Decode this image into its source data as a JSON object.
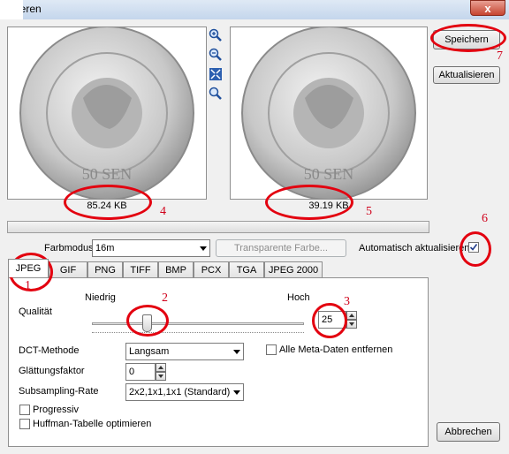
{
  "window": {
    "title": "ortieren",
    "close_glyph": "x"
  },
  "preview": {
    "original_size": "85.24 KB",
    "preview_size": "39.19 KB",
    "tools": [
      "zoom-in-icon",
      "zoom-out-icon",
      "fit-icon",
      "magnify-icon"
    ]
  },
  "buttons": {
    "save": "Speichern",
    "refresh": "Aktualisieren",
    "cancel": "Abbrechen",
    "transparent": "Transparente Farbe..."
  },
  "options_row": {
    "color_mode_label": "Farbmodus",
    "color_mode_value": "16m",
    "auto_update_label": "Automatisch aktualisieren",
    "auto_update_checked": true
  },
  "tabs": [
    "JPEG",
    "GIF",
    "PNG",
    "TIFF",
    "BMP",
    "PCX",
    "TGA",
    "JPEG 2000"
  ],
  "active_tab": "JPEG",
  "jpeg": {
    "quality_label": "Qualität",
    "low_label": "Niedrig",
    "high_label": "Hoch",
    "quality_value": "25",
    "quality_fraction": 0.25,
    "dct_label": "DCT-Methode",
    "dct_value": "Langsam",
    "remove_meta_label": "Alle Meta-Daten entfernen",
    "smoothing_label": "Glättungsfaktor",
    "smoothing_value": "0",
    "subsampling_label": "Subsampling-Rate",
    "subsampling_value": "2x2,1x1,1x1 (Standard)",
    "progressive_label": "Progressiv",
    "huffman_label": "Huffman-Tabelle optimieren"
  },
  "annotations": [
    "1",
    "2",
    "3",
    "4",
    "5",
    "6",
    "7"
  ],
  "colors": {
    "annotation": "#e3000f",
    "coin": "#c9c9c9"
  }
}
